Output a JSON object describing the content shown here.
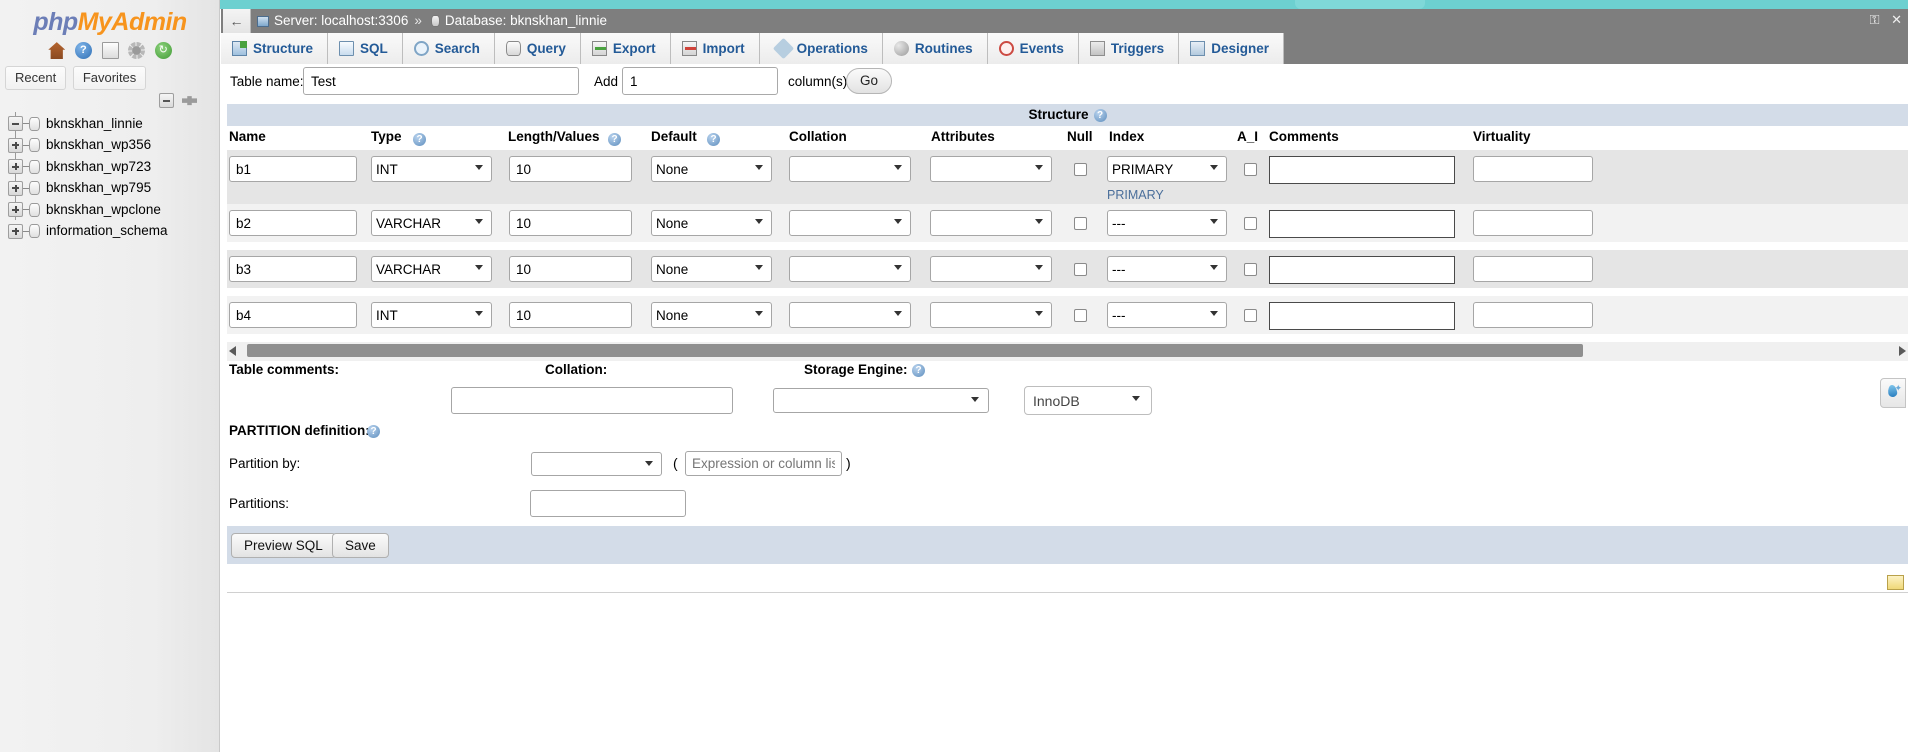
{
  "app": {
    "logo_php": "php",
    "logo_myadmin": "MyAdmin"
  },
  "sidebar": {
    "icons": [
      {
        "name": "home-icon",
        "glyph": ""
      },
      {
        "name": "help-icon",
        "glyph": "?"
      },
      {
        "name": "docs-icon",
        "glyph": ""
      },
      {
        "name": "settings-icon",
        "glyph": ""
      },
      {
        "name": "refresh-icon",
        "glyph": "↻"
      }
    ],
    "tabs": [
      {
        "label": "Recent"
      },
      {
        "label": "Favorites"
      }
    ],
    "collapse_all_title": "Collapse all",
    "databases": [
      {
        "label": "bknskhan_linnie",
        "expanded": true
      },
      {
        "label": "bknskhan_wp356",
        "expanded": false
      },
      {
        "label": "bknskhan_wp723",
        "expanded": false
      },
      {
        "label": "bknskhan_wp795",
        "expanded": false
      },
      {
        "label": "bknskhan_wpclone",
        "expanded": false
      },
      {
        "label": "information_schema",
        "expanded": false
      }
    ]
  },
  "breadcrumb": {
    "back_arrow": "←",
    "server": "Server: localhost:3306",
    "separator": "»",
    "database": "Database: bknskhan_linnie",
    "window_lock": "⚿",
    "window_close": "✕"
  },
  "navtabs": [
    {
      "label": "Structure",
      "icon": "structure-icon"
    },
    {
      "label": "SQL",
      "icon": "sql-icon"
    },
    {
      "label": "Search",
      "icon": "search-icon"
    },
    {
      "label": "Query",
      "icon": "query-icon"
    },
    {
      "label": "Export",
      "icon": "export-icon"
    },
    {
      "label": "Import",
      "icon": "import-icon"
    },
    {
      "label": "Operations",
      "icon": "operations-icon"
    },
    {
      "label": "Routines",
      "icon": "routines-icon"
    },
    {
      "label": "Events",
      "icon": "events-icon"
    },
    {
      "label": "Triggers",
      "icon": "triggers-icon"
    },
    {
      "label": "Designer",
      "icon": "designer-icon"
    }
  ],
  "tablebar": {
    "table_name_label": "Table name:",
    "table_name_value": "Test",
    "add_label": "Add",
    "add_value": "1",
    "columns_label": "column(s)",
    "go_label": "Go"
  },
  "structure": {
    "band_title": "Structure",
    "help_glyph": "?",
    "headers": [
      "Name",
      "Type",
      "Length/Values",
      "Default",
      "Collation",
      "Attributes",
      "Null",
      "Index",
      "A_I",
      "Comments",
      "Virtuality"
    ],
    "rows": [
      {
        "name": "b1",
        "type": "INT",
        "length": "10",
        "default": "None",
        "collation": "",
        "attributes": "",
        "null": false,
        "index": "PRIMARY",
        "index_note": "PRIMARY",
        "auto_increment": false,
        "comments": "",
        "virtuality": ""
      },
      {
        "name": "b2",
        "type": "VARCHAR",
        "length": "10",
        "default": "None",
        "collation": "",
        "attributes": "",
        "null": false,
        "index": "---",
        "index_note": "",
        "auto_increment": false,
        "comments": "",
        "virtuality": ""
      },
      {
        "name": "b3",
        "type": "VARCHAR",
        "length": "10",
        "default": "None",
        "collation": "",
        "attributes": "",
        "null": false,
        "index": "---",
        "index_note": "",
        "auto_increment": false,
        "comments": "",
        "virtuality": ""
      },
      {
        "name": "b4",
        "type": "INT",
        "length": "10",
        "default": "None",
        "collation": "",
        "attributes": "",
        "null": false,
        "index": "---",
        "index_note": "",
        "auto_increment": false,
        "comments": "",
        "virtuality": ""
      }
    ]
  },
  "lower_form": {
    "table_comments_label": "Table comments:",
    "table_comments_value": "",
    "collation_label": "Collation:",
    "collation_value": "",
    "storage_engine_label": "Storage Engine:",
    "storage_engine_value": "InnoDB",
    "partition_definition_label": "PARTITION definition:",
    "partition_by_label": "Partition by:",
    "partition_by_value": "",
    "paren_open": "(",
    "paren_close": ")",
    "expression_placeholder": "Expression or column list",
    "expression_value": "",
    "partitions_label": "Partitions:",
    "partitions_value": ""
  },
  "footer": {
    "preview_sql_label": "Preview SQL",
    "save_label": "Save"
  },
  "colors": {
    "teal": "#6dd0d0",
    "band": "#d3dce8",
    "breadcrumb_bg": "#7e7e7e",
    "tab_text": "#235a97",
    "logo_php": "#6c7eb7",
    "logo_myadmin": "#f7941d"
  }
}
